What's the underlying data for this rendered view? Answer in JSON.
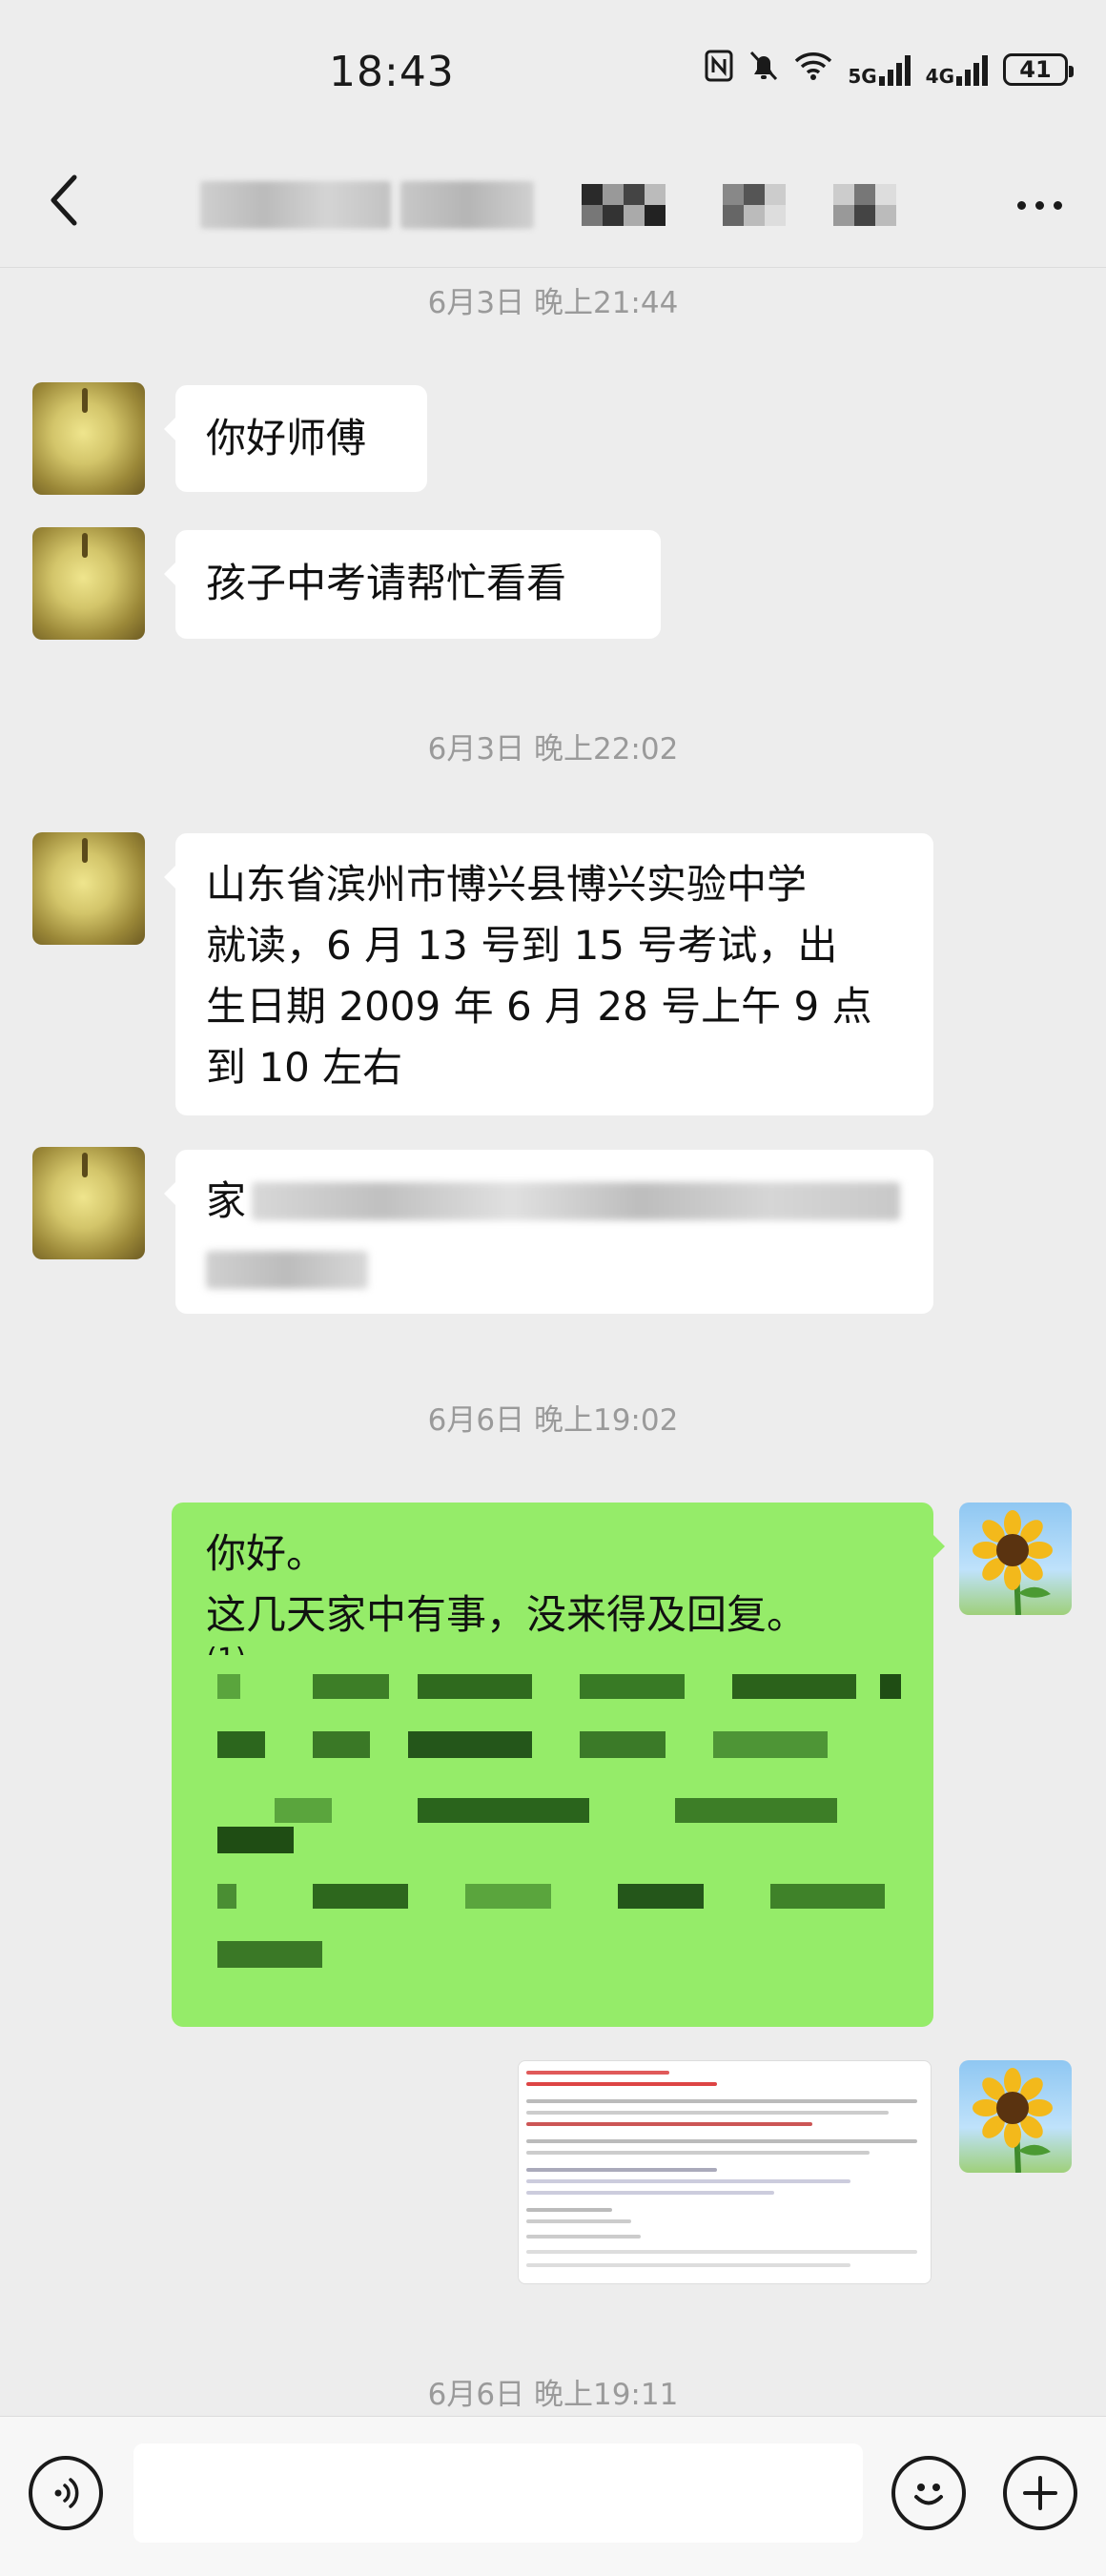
{
  "status_bar": {
    "time": "18:43",
    "network_5g": "5G",
    "network_4g": "4G",
    "battery": "41"
  },
  "header": {
    "back_icon": "chevron-left-icon",
    "more_icon": "more-horizontal-icon"
  },
  "messages": {
    "ts1": "6月3日 晚上21:44",
    "m1": "你好师傅",
    "m2": "孩子中考请帮忙看看",
    "ts2": "6月3日 晚上22:02",
    "m3_l1": "山东省滨州市博兴县博兴实验中学",
    "m3_l2": "就读，6 月 13 号到 15 号考试，出",
    "m3_l3": "生日期 2009 年 6 月 28 号上午 9 点",
    "m3_l4": "到 10 左右",
    "m4_visible": "家",
    "ts3": "6月6日 晚上19:02",
    "m5_l1": "你好。",
    "m5_l2": "这几天家中有事，没来得及回复。",
    "m5_l3_prefix": "(1)",
    "m5_l6_prefix": "(",
    "ts4": "6月6日 晚上19:11"
  },
  "input_bar": {
    "voice_icon": "voice-icon",
    "emoji_icon": "emoji-icon",
    "plus_icon": "plus-icon"
  },
  "colors": {
    "background": "#ededed",
    "self_bubble": "#95ec69",
    "other_bubble": "#ffffff",
    "timestamp": "#9a9a9a"
  }
}
